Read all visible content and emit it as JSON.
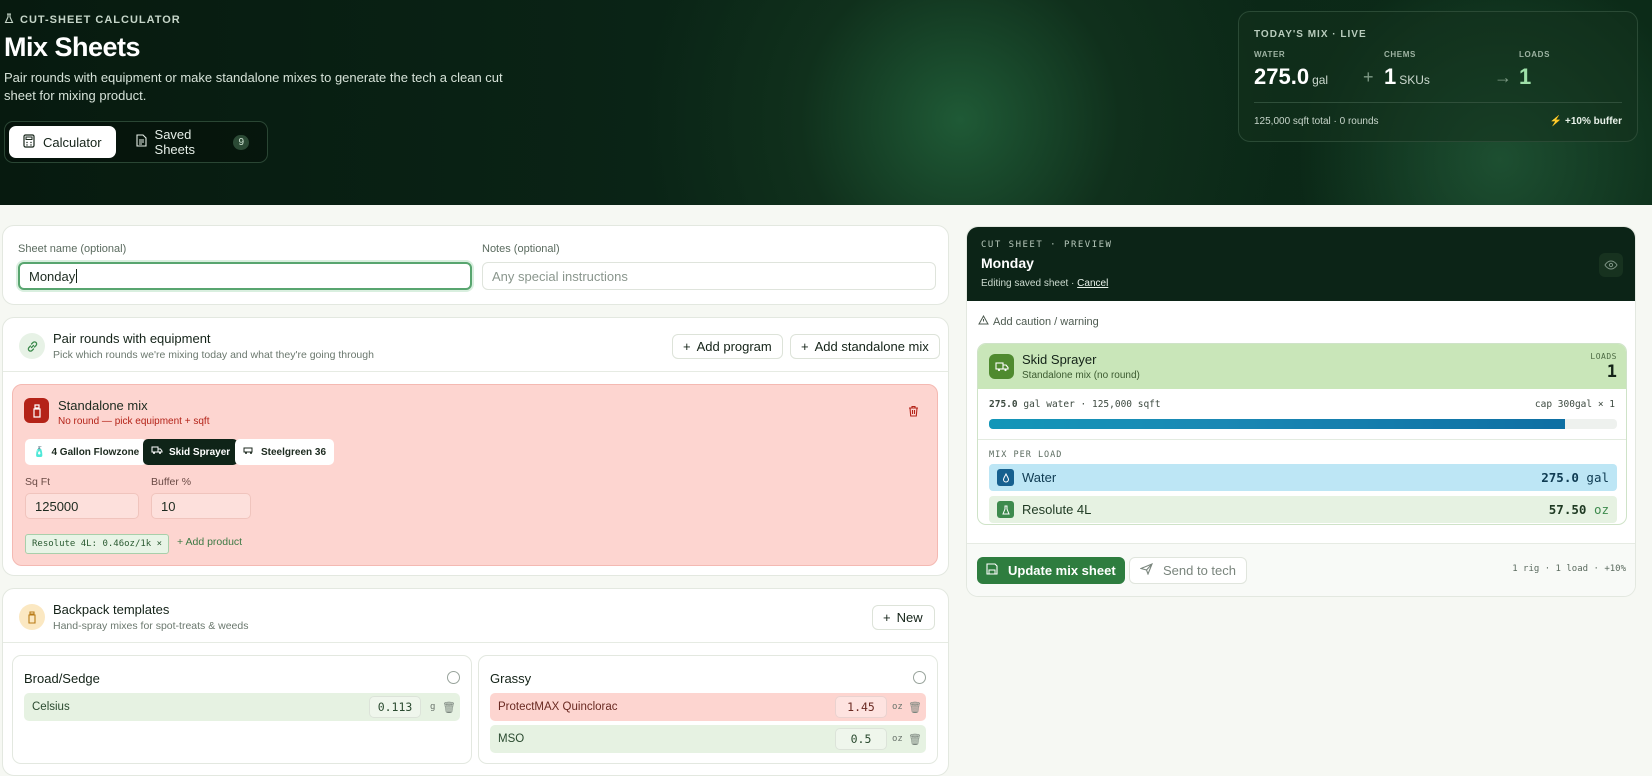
{
  "header": {
    "eyebrow": "CUT-SHEET CALCULATOR",
    "title": "Mix Sheets",
    "subtitle": "Pair rounds with equipment or make standalone mixes to generate the tech a clean cut sheet for mixing product.",
    "tabs": [
      {
        "label": "Calculator",
        "active": true
      },
      {
        "label": "Saved Sheets",
        "badge": "9"
      }
    ]
  },
  "live": {
    "title": "TODAY'S MIX · LIVE",
    "water_label": "WATER",
    "water_value": "275.0",
    "water_unit": "gal",
    "chems_label": "CHEMS",
    "chems_value": "1",
    "chems_unit": "SKUs",
    "loads_label": "LOADS",
    "loads_value": "1",
    "footer": "125,000 sqft total · 0 rounds",
    "buffer": "+10% buffer"
  },
  "sheet": {
    "name_label": "Sheet name (optional)",
    "name_value": "Monday",
    "notes_label": "Notes (optional)",
    "notes_placeholder": "Any special instructions"
  },
  "pair": {
    "title": "Pair rounds with equipment",
    "subtitle": "Pick which rounds we're mixing today and what they're going through",
    "add_program": "Add program",
    "add_standalone": "Add standalone mix"
  },
  "standalone": {
    "title": "Standalone mix",
    "subtitle": "No round — pick equipment + sqft",
    "equipment": [
      {
        "label": "4 Gallon Flowzone",
        "selected": false
      },
      {
        "label": "Skid Sprayer",
        "selected": true
      },
      {
        "label": "Steelgreen 36",
        "selected": false
      }
    ],
    "sqft_label": "Sq Ft",
    "sqft_value": "125000",
    "buffer_label": "Buffer %",
    "buffer_value": "10",
    "product_chip": "Resolute 4L: 0.46oz/1k ×",
    "add_product": "+ Add product"
  },
  "backpack": {
    "title": "Backpack templates",
    "subtitle": "Hand-spray mixes for spot-treats & weeds",
    "new_label": "New",
    "templates": [
      {
        "name": "Broad/Sedge",
        "products": [
          {
            "name": "Celsius",
            "qty": "0.113",
            "unit": "g",
            "status": "ok"
          }
        ]
      },
      {
        "name": "Grassy",
        "products": [
          {
            "name": "ProtectMAX Quinclorac",
            "qty": "1.45",
            "unit": "oz",
            "status": "warn"
          },
          {
            "name": "MSO",
            "qty": "0.5",
            "unit": "oz",
            "status": "ok"
          }
        ]
      }
    ]
  },
  "preview": {
    "eyebrow": "CUT SHEET · PREVIEW",
    "title": "Monday",
    "editing": "Editing saved sheet ·",
    "cancel": "Cancel",
    "caution": "Add caution / warning",
    "rig_name": "Skid Sprayer",
    "rig_sub": "Standalone mix (no round)",
    "loads_label": "LOADS",
    "loads_value": "1",
    "water_summary_bold": "275.0",
    "water_summary_rest": "gal water · 125,000 sqft",
    "cap": "cap 300gal × 1",
    "fill_fraction": 0.917,
    "mix_label": "MIX PER LOAD",
    "mix_rows": [
      {
        "name": "Water",
        "amount": "275.0",
        "unit": "gal"
      },
      {
        "name": "Resolute 4L",
        "amount": "57.50",
        "unit": "oz"
      }
    ],
    "update_button": "Update mix sheet",
    "send_button": "Send to tech",
    "footer_summary": "1 rig · 1 load · +10%"
  },
  "colors": {
    "brand_dark": "#0c2417",
    "accent_green": "#2e7d3f",
    "mix_red": "#fdd5d0",
    "water_blue": "#bde6f5"
  }
}
